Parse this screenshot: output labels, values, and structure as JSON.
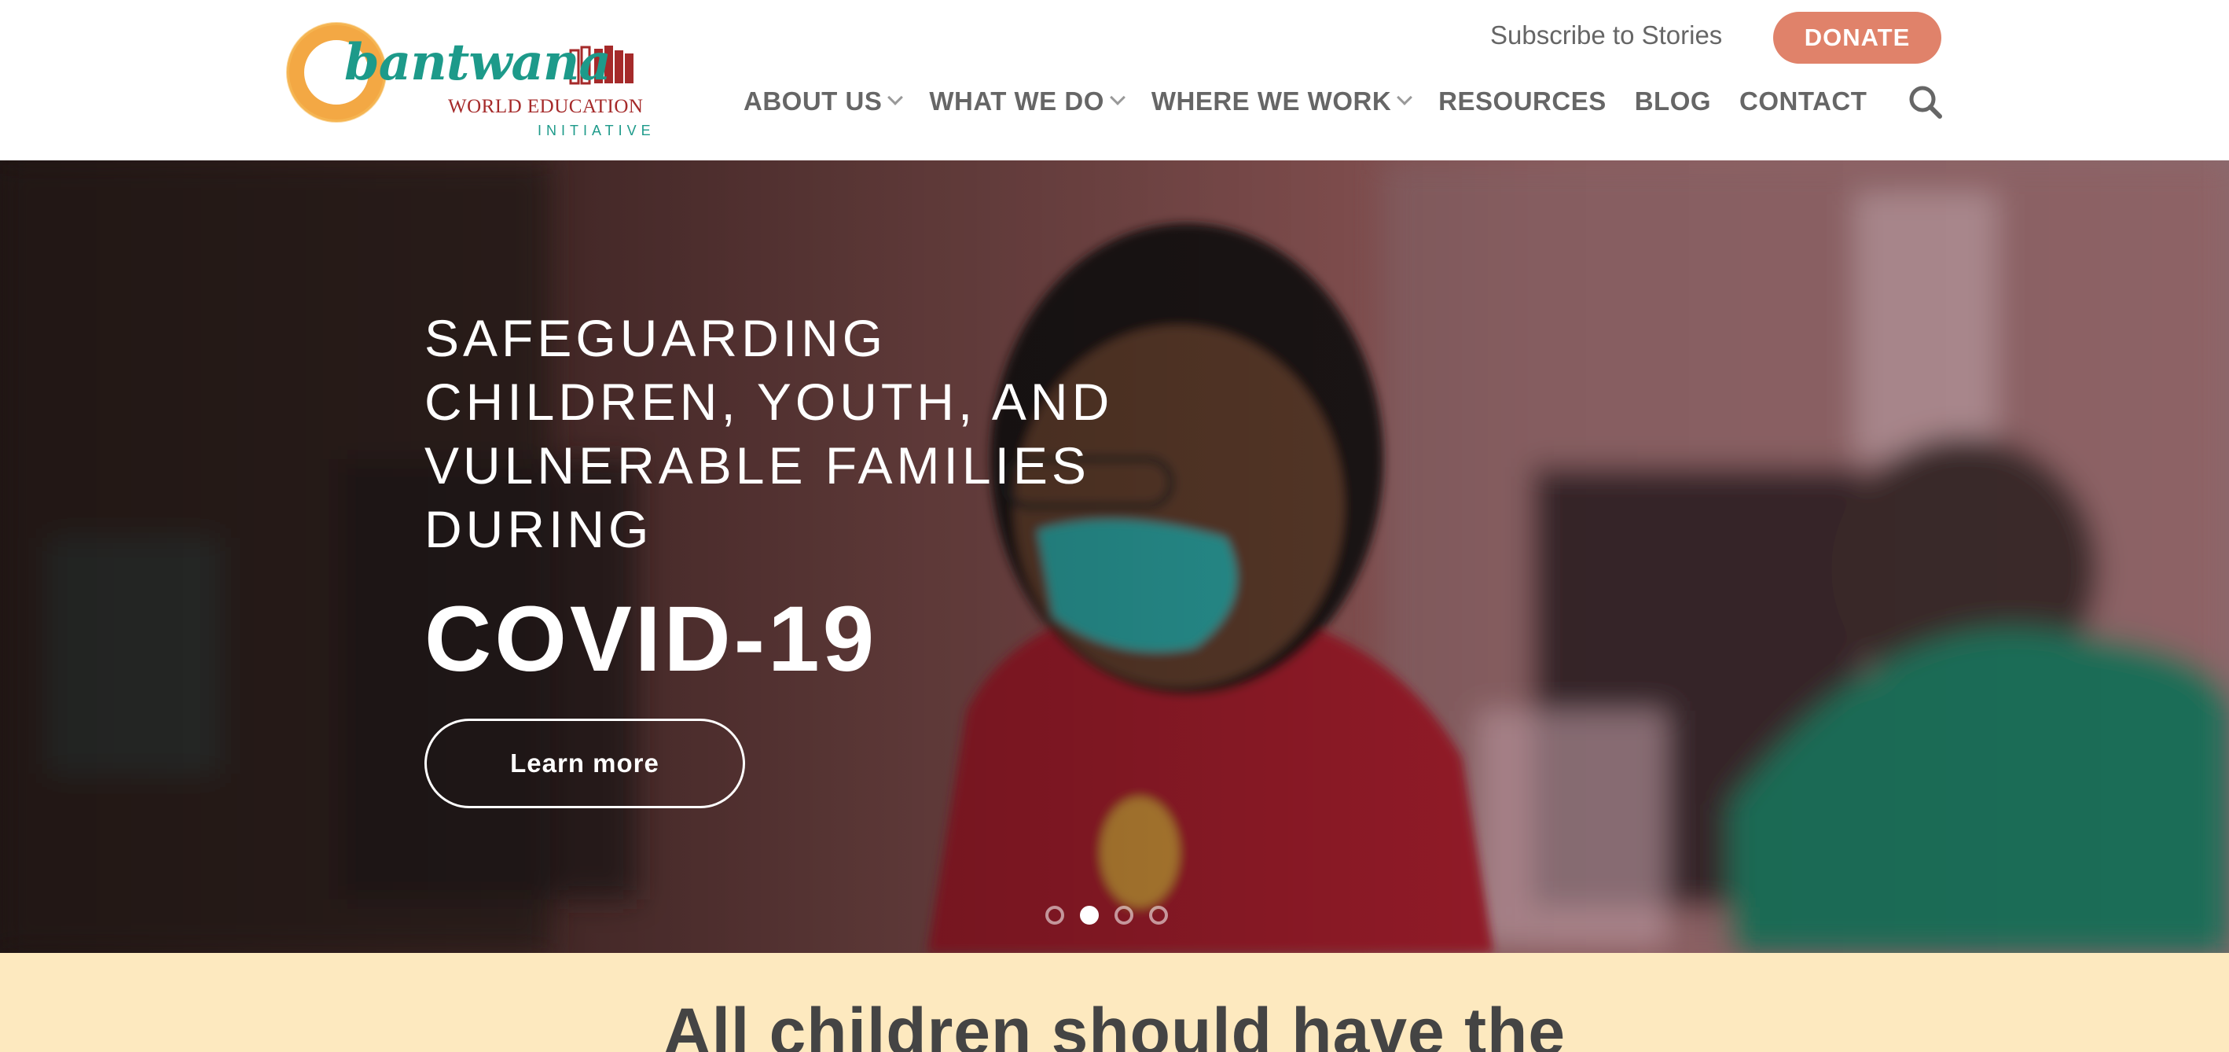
{
  "header": {
    "logo": {
      "brand": "bantwana",
      "org": "WORLD EDUCATION",
      "tagline": "INITIATIVE"
    },
    "subscribe_label": "Subscribe to Stories",
    "donate_label": "DONATE",
    "nav": [
      {
        "label": "ABOUT US",
        "dropdown": true
      },
      {
        "label": "WHAT WE DO",
        "dropdown": true
      },
      {
        "label": "WHERE WE WORK",
        "dropdown": true
      },
      {
        "label": "RESOURCES",
        "dropdown": false
      },
      {
        "label": "BLOG",
        "dropdown": false
      },
      {
        "label": "CONTACT",
        "dropdown": false
      }
    ],
    "search_icon": "search-icon"
  },
  "hero": {
    "subtitle_lines": [
      "SAFEGUARDING",
      "CHILDREN, YOUTH, AND",
      "VULNERABLE FAMILIES",
      "DURING"
    ],
    "title": "COVID-19",
    "cta_label": "Learn more",
    "slides": {
      "count": 4,
      "active_index": 1
    }
  },
  "banner": {
    "text": "All children should have the"
  },
  "colors": {
    "accent_donate": "#e0826a",
    "brand_teal": "#1d9a8a",
    "brand_orange": "#f2a33a",
    "brand_red": "#a52a2a",
    "banner_bg": "#fde9bf"
  }
}
